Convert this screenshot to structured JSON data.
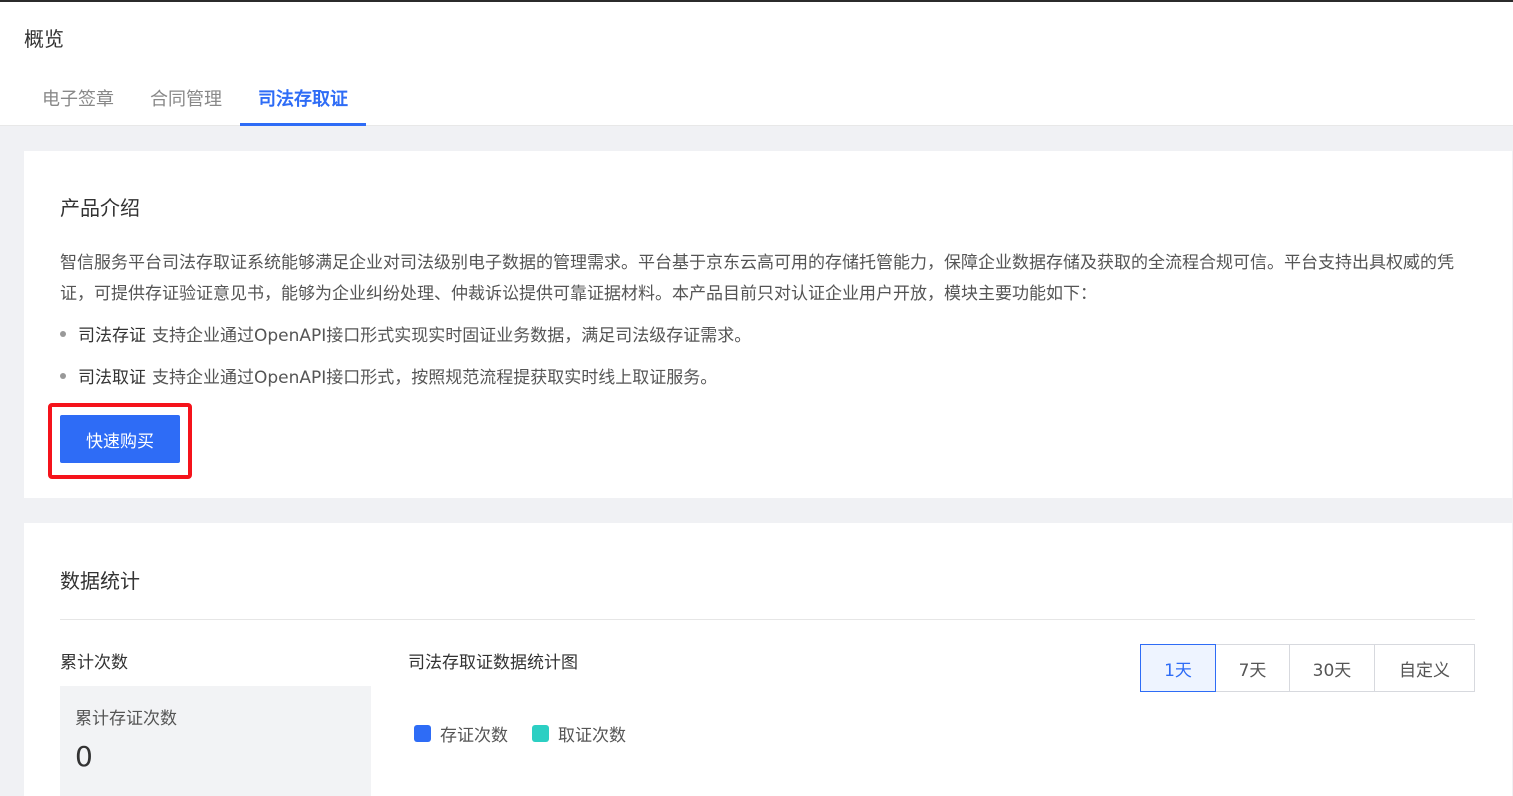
{
  "header": {
    "title": "概览",
    "tabs": [
      {
        "label": "电子签章",
        "active": false
      },
      {
        "label": "合同管理",
        "active": false
      },
      {
        "label": "司法存取证",
        "active": true
      }
    ]
  },
  "intro": {
    "title": "产品介绍",
    "description": "智信服务平台司法存取证系统能够满足企业对司法级别电子数据的管理需求。平台基于京东云高可用的存储托管能力，保障企业数据存储及获取的全流程合规可信。平台支持出具权威的凭证，可提供存证验证意见书，能够为企业纠纷处理、仲裁诉讼提供可靠证据材料。本产品目前只对认证企业用户开放，模块主要功能如下：",
    "features": [
      {
        "name": "司法存证",
        "text": "支持企业通过OpenAPI接口形式实现实时固证业务数据，满足司法级存证需求。"
      },
      {
        "name": "司法取证",
        "text": "支持企业通过OpenAPI接口形式，按照规范流程提获取实时线上取证服务。"
      }
    ],
    "buy_label": "快速购买",
    "highlight_color": "#f5131b",
    "accent_color": "#2e6cf6"
  },
  "stats": {
    "title": "数据统计",
    "cumulative_title": "累计次数",
    "cumulative_label": "累计存证次数",
    "cumulative_value": "0",
    "chart_title": "司法存取证数据统计图",
    "ranges": [
      {
        "label": "1天",
        "active": true
      },
      {
        "label": "7天",
        "active": false
      },
      {
        "label": "30天",
        "active": false
      },
      {
        "label": "自定义",
        "active": false
      }
    ],
    "legend": [
      {
        "label": "存证次数",
        "color": "#2e6cf6"
      },
      {
        "label": "取证次数",
        "color": "#2ccfc3"
      }
    ]
  }
}
